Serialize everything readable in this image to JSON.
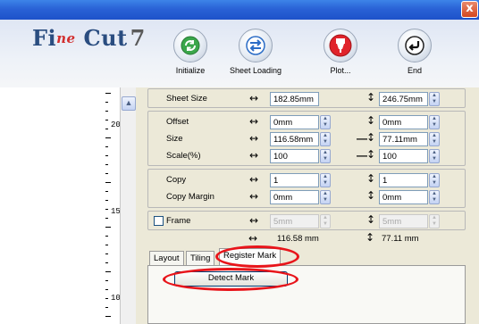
{
  "titlebar": {
    "close_label": "x"
  },
  "logo": {
    "part1": "Fi",
    "part2": "ne",
    "part3": "Cut",
    "part4": "7"
  },
  "toolbar": {
    "items": [
      {
        "label": "Initialize",
        "icon": "refresh-icon"
      },
      {
        "label": "Sheet Loading",
        "icon": "swap-arrows-icon"
      },
      {
        "label": "Plot...",
        "icon": "cutter-plot-icon"
      },
      {
        "label": "End",
        "icon": "return-arrow-icon"
      }
    ]
  },
  "ruler": {
    "labels": [
      "200",
      "150",
      "100"
    ]
  },
  "settings": {
    "sheet_size": {
      "label": "Sheet Size",
      "width": "182.85mm",
      "height": "246.75mm"
    },
    "offset": {
      "label": "Offset",
      "x": "0mm",
      "y": "0mm"
    },
    "size": {
      "label": "Size",
      "x": "116.58mm",
      "y": "77.11mm"
    },
    "scale": {
      "label": "Scale(%)",
      "x": "100",
      "y": "100"
    },
    "copy": {
      "label": "Copy",
      "x": "1",
      "y": "1"
    },
    "copy_margin": {
      "label": "Copy Margin",
      "x": "0mm",
      "y": "0mm"
    },
    "frame": {
      "label": "Frame",
      "x": "5mm",
      "y": "5mm",
      "checked": false
    },
    "summary": {
      "width": "116.58 mm",
      "height": "77.11 mm"
    }
  },
  "tabs": {
    "items": [
      "Layout",
      "Tiling",
      "Register Mark"
    ],
    "active": "Register Mark"
  },
  "register_mark": {
    "detect_label": "Detect Mark"
  },
  "colors": {
    "title_bar": "#2a62d6",
    "highlight": "#e8141a",
    "logo_blue": "#2a4d80",
    "logo_red": "#d22e2e"
  }
}
